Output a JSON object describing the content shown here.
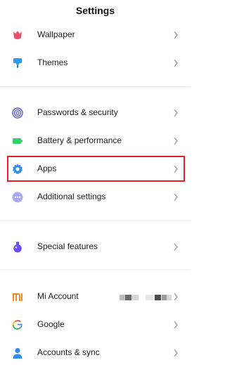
{
  "header": {
    "title": "Settings"
  },
  "items": {
    "wallpaper": {
      "label": "Wallpaper",
      "icon": "tulip-icon",
      "color": "#e9506d"
    },
    "themes": {
      "label": "Themes",
      "icon": "paint-roller-icon",
      "color": "#2e9bee"
    },
    "passwords": {
      "label": "Passwords & security",
      "icon": "fingerprint-icon",
      "color": "#5b5cd6"
    },
    "battery": {
      "label": "Battery & performance",
      "icon": "battery-icon",
      "color": "#2fcf6a"
    },
    "apps": {
      "label": "Apps",
      "icon": "gear-icon",
      "color": "#2f8ff0"
    },
    "additional": {
      "label": "Additional settings",
      "icon": "more-dots-icon",
      "color": "#a7aaf2"
    },
    "special": {
      "label": "Special features",
      "icon": "potion-icon",
      "color": "#6d4ef2"
    },
    "mi_account": {
      "label": "Mi Account",
      "icon": "mi-logo-icon",
      "color": "#f08a24"
    },
    "google": {
      "label": "Google",
      "icon": "google-icon"
    },
    "accounts_sync": {
      "label": "Accounts & sync",
      "icon": "person-icon",
      "color": "#2f8ff0"
    }
  },
  "colors": {
    "highlight": "#e0202c",
    "chevron": "#9a9a9a"
  }
}
